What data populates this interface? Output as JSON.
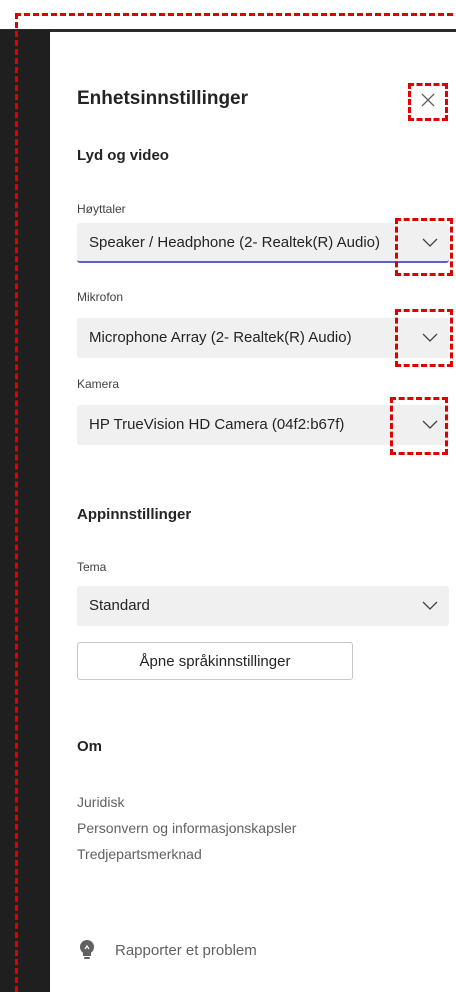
{
  "panel": {
    "title": "Enhetsinnstillinger",
    "close_icon": "close-icon"
  },
  "audio_video": {
    "heading": "Lyd og video",
    "speaker": {
      "label": "Høyttaler",
      "value": "Speaker / Headphone (2- Realtek(R) Audio)"
    },
    "microphone": {
      "label": "Mikrofon",
      "value": "Microphone Array (2- Realtek(R) Audio)"
    },
    "camera": {
      "label": "Kamera",
      "value": "HP TrueVision HD Camera (04f2:b67f)"
    }
  },
  "app_settings": {
    "heading": "Appinnstillinger",
    "theme": {
      "label": "Tema",
      "value": "Standard"
    },
    "language_button": "Åpne språkinnstillinger"
  },
  "about": {
    "heading": "Om",
    "links": [
      "Juridisk",
      "Personvern og informasjonskapsler",
      "Tredjepartsmerknad"
    ]
  },
  "report": {
    "label": "Rapporter et problem",
    "icon": "lightbulb-icon"
  },
  "colors": {
    "accent": "#5b5fc7",
    "annotation": "#e00000",
    "rail": "#1f1f1f",
    "field_bg": "#f0f0f0"
  }
}
